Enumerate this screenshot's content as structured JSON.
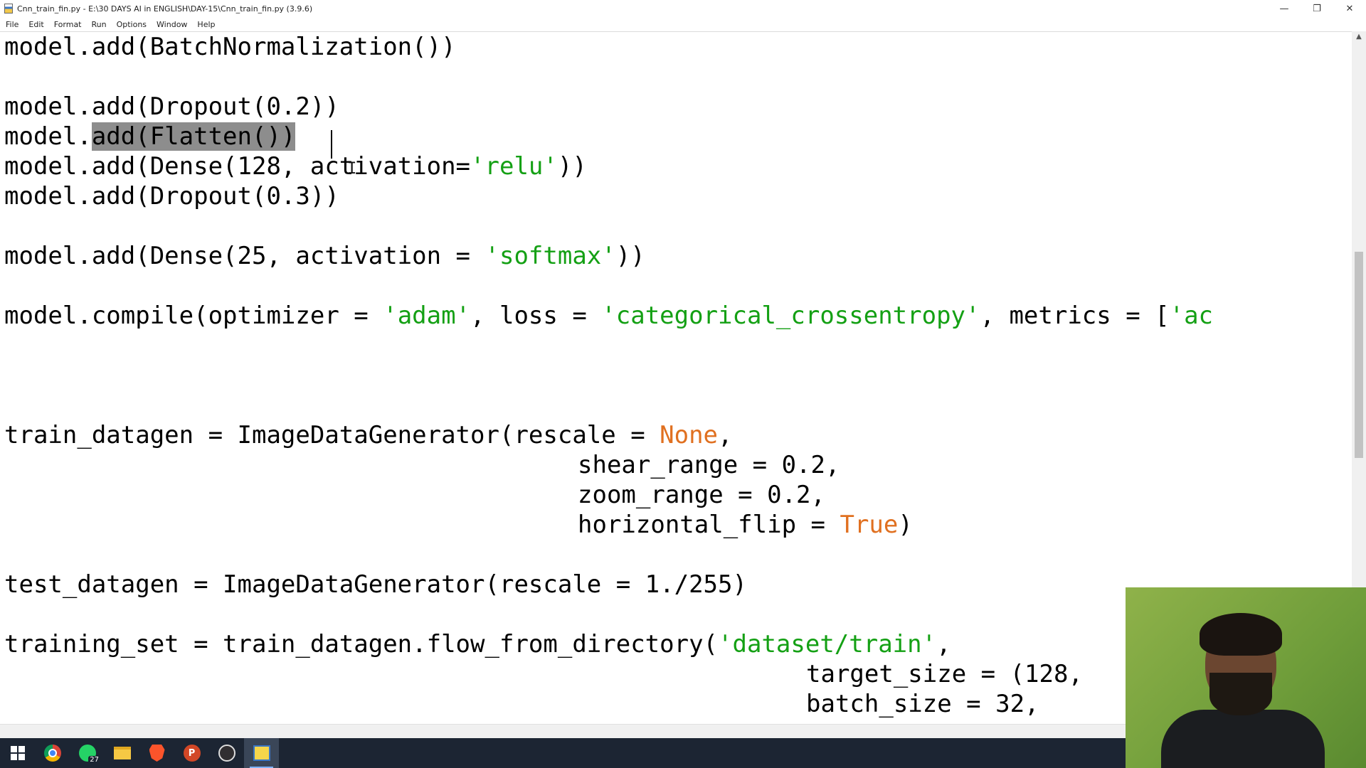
{
  "window": {
    "title": "Cnn_train_fin.py - E:\\30 DAYS AI in ENGLISH\\DAY-15\\Cnn_train_fin.py (3.9.6)",
    "minimize_glyph": "—",
    "restore_glyph": "❐",
    "close_glyph": "✕"
  },
  "menu": [
    "File",
    "Edit",
    "Format",
    "Run",
    "Options",
    "Window",
    "Help"
  ],
  "code": {
    "line1": "model.add(BatchNormalization())",
    "line2": "model.add(Dropout(0.2))",
    "line3_prefix": "model.",
    "line3_selected": "add(Flatten())",
    "line4_pre": "model.add(Dense(128, activation=",
    "line4_str": "'relu'",
    "line4_post": "))",
    "line5": "model.add(Dropout(0.3))",
    "line6_pre": "model.add(Dense(25, activation = ",
    "line6_str": "'softmax'",
    "line6_post": "))",
    "line7_pre": "model.compile(optimizer = ",
    "line7_str1": "'adam'",
    "line7_mid": ", loss = ",
    "line7_str2": "'categorical_crossentropy'",
    "line7_post": ", metrics = [",
    "line7_str3": "'ac",
    "line8_pre": "train_datagen = ImageDataGenerator(rescale = ",
    "line8_kw": "None",
    "line8_post": ",",
    "line9": "shear_range = 0.2,",
    "line10": "zoom_range = 0.2,",
    "line11_pre": "horizontal_flip = ",
    "line11_kw": "True",
    "line11_post": ")",
    "line12": "test_datagen = ImageDataGenerator(rescale = 1./255)",
    "line13_pre": "training_set = train_datagen.flow_from_directory(",
    "line13_str": "'dataset/train'",
    "line13_post": ",",
    "line14": "target_size = (128,",
    "line15": "batch_size = 32,"
  },
  "taskbar": {
    "whatsapp_badge": "27",
    "powerpoint_letter": "P",
    "apps": [
      "start",
      "chrome",
      "whatsapp",
      "file-explorer",
      "brave",
      "powerpoint",
      "obs",
      "python-idle"
    ]
  }
}
